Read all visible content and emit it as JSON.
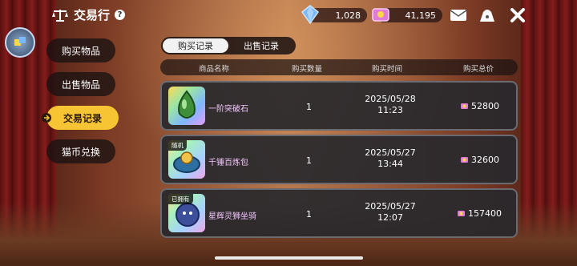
{
  "header": {
    "title": "交易行"
  },
  "currencies": {
    "gems": "1,028",
    "coins": "41,195"
  },
  "sidebar": {
    "items": [
      {
        "label": "购买物品"
      },
      {
        "label": "出售物品"
      },
      {
        "label": "交易记录"
      },
      {
        "label": "猫币兑换"
      }
    ]
  },
  "tabs": [
    {
      "label": "购买记录"
    },
    {
      "label": "出售记录"
    }
  ],
  "table": {
    "headers": [
      "商品名称",
      "购买数量",
      "购买时间",
      "购买总价"
    ],
    "rows": [
      {
        "name": "一阶突破石",
        "qty": "1",
        "date": "2025/05/28",
        "time": "11:23",
        "price": "52800",
        "tag": ""
      },
      {
        "name": "千锤百炼包",
        "qty": "1",
        "date": "2025/05/27",
        "time": "13:44",
        "price": "32600",
        "tag": "随机"
      },
      {
        "name": "星辉灵狮坐骑",
        "qty": "1",
        "date": "2025/05/27",
        "time": "12:07",
        "price": "157400",
        "tag": "已拥有"
      }
    ]
  },
  "colors": {
    "accent": "#f7c433",
    "panel": "#28282c",
    "name_text": "#f3c8ff"
  }
}
